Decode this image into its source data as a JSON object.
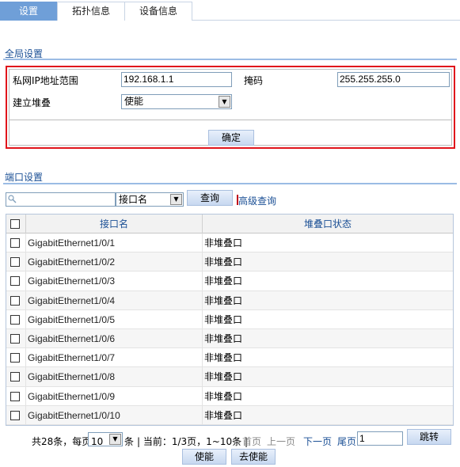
{
  "tabs": [
    {
      "label": "设置"
    },
    {
      "label": "拓扑信息"
    },
    {
      "label": "设备信息"
    }
  ],
  "global": {
    "title": "全局设置",
    "ip_range_label": "私网IP地址范围",
    "ip_range_value": "192.168.1.1",
    "mask_label": "掩码",
    "mask_value": "255.255.255.0",
    "stack_label": "建立堆叠",
    "stack_value": "使能",
    "confirm_label": "确定"
  },
  "port": {
    "title": "端口设置",
    "search_placeholder": "",
    "field_select": "接口名",
    "query_label": "查询",
    "advanced_label": "高级查询",
    "columns": [
      "接口名",
      "堆叠口状态"
    ],
    "rows": [
      {
        "name": "GigabitEthernet1/0/1",
        "status": "非堆叠口"
      },
      {
        "name": "GigabitEthernet1/0/2",
        "status": "非堆叠口"
      },
      {
        "name": "GigabitEthernet1/0/3",
        "status": "非堆叠口"
      },
      {
        "name": "GigabitEthernet1/0/4",
        "status": "非堆叠口"
      },
      {
        "name": "GigabitEthernet1/0/5",
        "status": "非堆叠口"
      },
      {
        "name": "GigabitEthernet1/0/6",
        "status": "非堆叠口"
      },
      {
        "name": "GigabitEthernet1/0/7",
        "status": "非堆叠口"
      },
      {
        "name": "GigabitEthernet1/0/8",
        "status": "非堆叠口"
      },
      {
        "name": "GigabitEthernet1/0/9",
        "status": "非堆叠口"
      },
      {
        "name": "GigabitEthernet1/0/10",
        "status": "非堆叠口"
      }
    ]
  },
  "pager": {
    "total_text": "共28条，每页",
    "page_size": "10",
    "unit_text": "条",
    "current_text": "| 当前：1/3页，1~10条 |",
    "first": "首页",
    "prev": "上一页",
    "next": "下一页",
    "last": "尾页",
    "page_input": "1",
    "goto_label": "跳转"
  },
  "actions": {
    "enable_label": "使能",
    "disable_label": "去使能"
  },
  "colors": {
    "tab_active": "#6f9fd8",
    "highlight_border": "#e0141b",
    "link": "#1a4f95"
  }
}
